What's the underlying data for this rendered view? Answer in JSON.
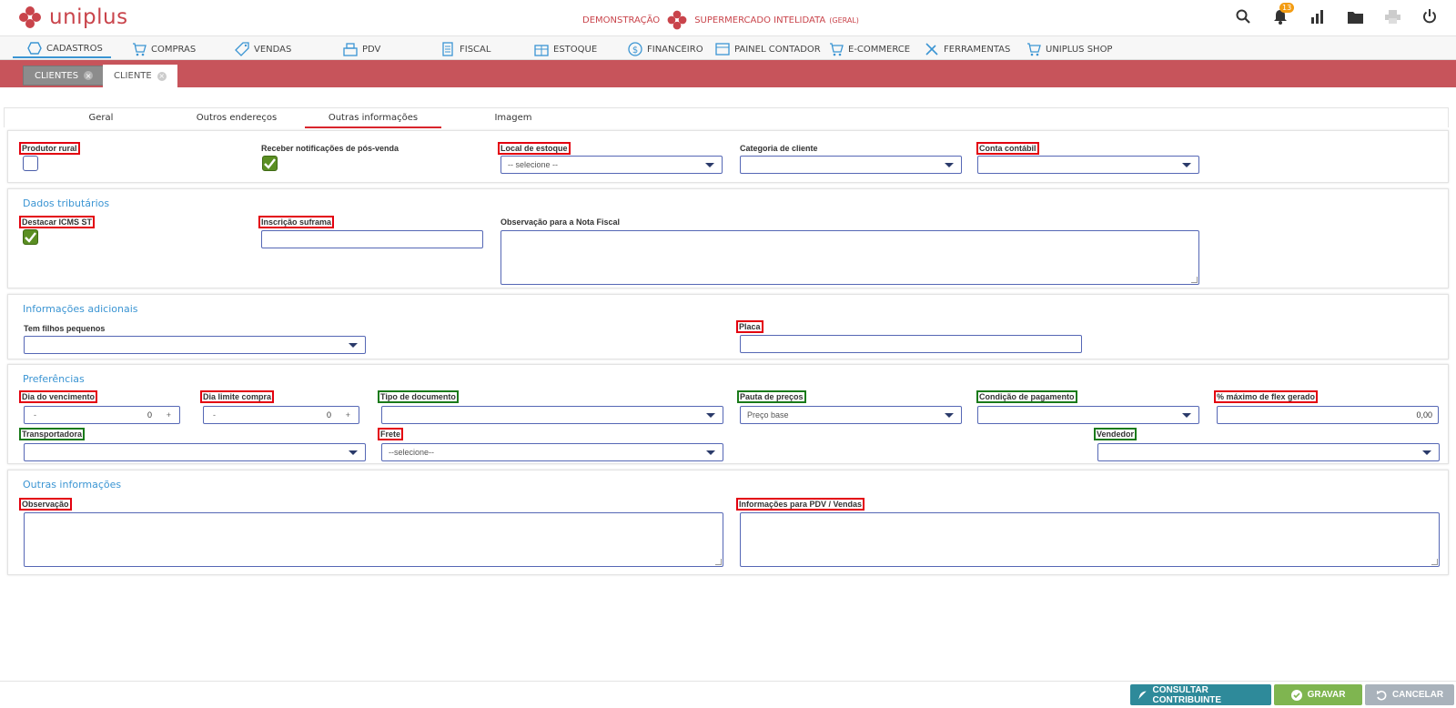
{
  "app": {
    "logo_text": "uniplus",
    "demo_label": "DEMONSTRAÇÃO",
    "company": "SUPERMERCADO INTELIDATA",
    "company_scope": "(GERAL)",
    "notifications_count": "13"
  },
  "menu": [
    {
      "label": "CADASTROS",
      "icon": "hexagon-icon"
    },
    {
      "label": "COMPRAS",
      "icon": "cart-icon"
    },
    {
      "label": "VENDAS",
      "icon": "tag-icon"
    },
    {
      "label": "PDV",
      "icon": "register-icon"
    },
    {
      "label": "FISCAL",
      "icon": "document-icon"
    },
    {
      "label": "ESTOQUE",
      "icon": "box-icon"
    },
    {
      "label": "FINANCEIRO",
      "icon": "dollar-icon"
    },
    {
      "label": "PAINEL CONTADOR",
      "icon": "ledger-icon"
    },
    {
      "label": "E-COMMERCE",
      "icon": "cart-icon"
    },
    {
      "label": "FERRAMENTAS",
      "icon": "tools-icon"
    },
    {
      "label": "UNIPLUS SHOP",
      "icon": "cart-icon"
    }
  ],
  "doc_tabs": [
    {
      "label": "CLIENTES",
      "state": "inactive"
    },
    {
      "label": "CLIENTE",
      "state": "active"
    }
  ],
  "subtabs": [
    "Geral",
    "Outros endereços",
    "Outras informações",
    "Imagem"
  ],
  "section_top": {
    "produtor_rural": "Produtor rural",
    "receber_notificacoes": "Receber notificações de pós-venda",
    "local_estoque": "Local de estoque",
    "local_estoque_value": "-- selecione --",
    "categoria_cliente": "Categoria de cliente",
    "conta_contabil": "Conta contábil"
  },
  "dados_tributarios": {
    "title": "Dados tributários",
    "destacar_icms": "Destacar ICMS ST",
    "inscricao_suframa": "Inscrição suframa",
    "observacao_nf": "Observação para a Nota Fiscal"
  },
  "info_adicionais": {
    "title": "Informações adicionais",
    "tem_filhos": "Tem filhos pequenos",
    "placa": "Placa"
  },
  "preferencias": {
    "title": "Preferências",
    "dia_vencimento": "Dia do vencimento",
    "dia_vencimento_value": "0",
    "dia_limite": "Dia limite compra",
    "dia_limite_value": "0",
    "tipo_documento": "Tipo de documento",
    "pauta_precos": "Pauta de preços",
    "pauta_precos_value": "Preço base",
    "condicao_pagamento": "Condição de pagamento",
    "max_flex": "% máximo de flex gerado",
    "max_flex_value": "0,00",
    "transportadora": "Transportadora",
    "frete": "Frete",
    "frete_value": "--selecione--",
    "vendedor": "Vendedor",
    "minus": "-",
    "plus": "+"
  },
  "outras_info": {
    "title": "Outras informações",
    "observacao": "Observação",
    "info_pdv": "Informações para PDV / Vendas"
  },
  "footer": {
    "consultar": "CONSULTAR CONTRIBUINTE",
    "gravar": "GRAVAR",
    "cancelar": "CANCELAR"
  },
  "colors": {
    "brand": "#c9444b",
    "accent": "#3b95d3",
    "highlight_red": "#e3000f",
    "highlight_green": "#1a7a1a"
  }
}
